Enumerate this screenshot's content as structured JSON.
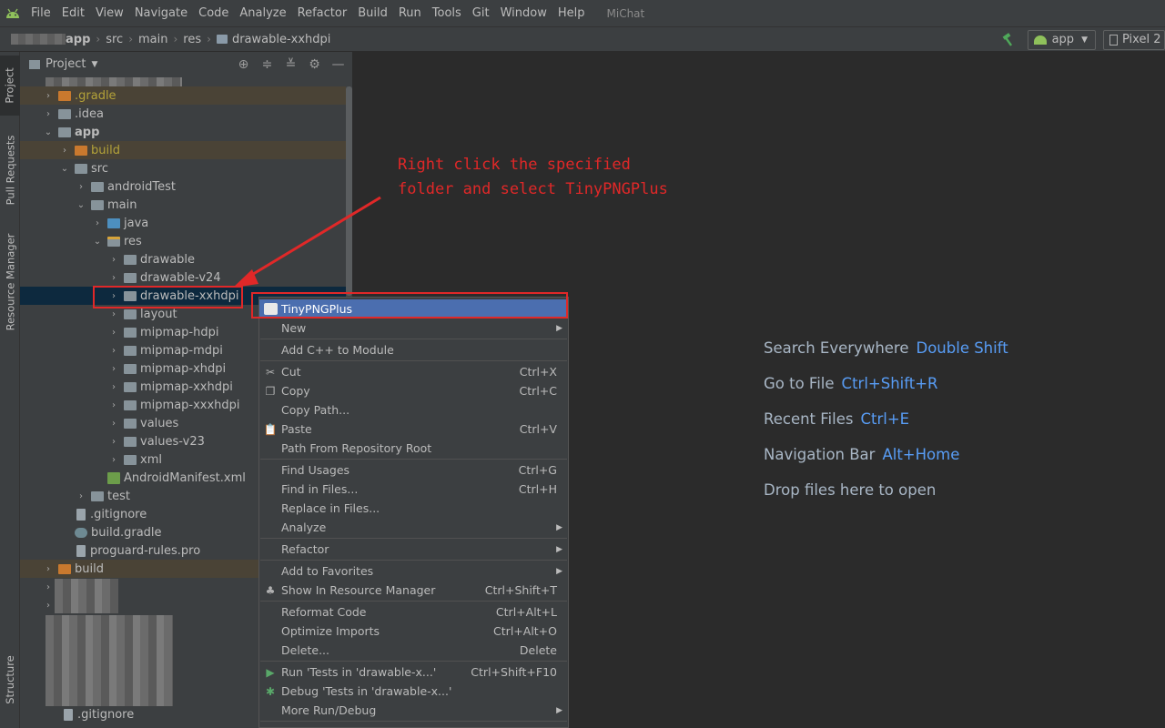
{
  "menubar": {
    "items": [
      {
        "label": "File"
      },
      {
        "label": "Edit"
      },
      {
        "label": "View"
      },
      {
        "label": "Navigate"
      },
      {
        "label": "Code"
      },
      {
        "label": "Analyze"
      },
      {
        "label": "Refactor"
      },
      {
        "label": "Build"
      },
      {
        "label": "Run"
      },
      {
        "label": "Tools"
      },
      {
        "label": "Git"
      },
      {
        "label": "Window"
      },
      {
        "label": "Help"
      }
    ],
    "project_name": "MiChat"
  },
  "navbar": {
    "breadcrumbs": [
      "app",
      "src",
      "main",
      "res",
      "drawable-xxhdpi"
    ],
    "run_config": "app",
    "device": "Pixel 2"
  },
  "toolstrip": {
    "project": "Project",
    "pull_requests": "Pull Requests",
    "resource_manager": "Resource Manager",
    "structure": "Structure"
  },
  "project_panel": {
    "title": "Project",
    "tree": [
      {
        "label": ".gradle",
        "expanded": false
      },
      {
        "label": ".idea",
        "expanded": false
      },
      {
        "label": "app",
        "expanded": true
      },
      {
        "label": "build",
        "expanded": false
      },
      {
        "label": "src",
        "expanded": true
      },
      {
        "label": "androidTest",
        "expanded": false
      },
      {
        "label": "main",
        "expanded": true
      },
      {
        "label": "java",
        "expanded": false
      },
      {
        "label": "res",
        "expanded": true
      },
      {
        "label": "drawable",
        "expanded": false
      },
      {
        "label": "drawable-v24",
        "expanded": false
      },
      {
        "label": "drawable-xxhdpi",
        "expanded": false
      },
      {
        "label": "layout",
        "expanded": false
      },
      {
        "label": "mipmap-hdpi",
        "expanded": false
      },
      {
        "label": "mipmap-mdpi",
        "expanded": false
      },
      {
        "label": "mipmap-xhdpi",
        "expanded": false
      },
      {
        "label": "mipmap-xxhdpi",
        "expanded": false
      },
      {
        "label": "mipmap-xxxhdpi",
        "expanded": false
      },
      {
        "label": "values",
        "expanded": false
      },
      {
        "label": "values-v23",
        "expanded": false
      },
      {
        "label": "xml",
        "expanded": false
      },
      {
        "label": "AndroidManifest.xml"
      },
      {
        "label": "test",
        "expanded": false
      },
      {
        "label": ".gitignore"
      },
      {
        "label": "build.gradle"
      },
      {
        "label": "proguard-rules.pro"
      },
      {
        "label": "build",
        "expanded": false
      },
      {
        "label": ".gitignore"
      }
    ]
  },
  "editor": {
    "hints": [
      {
        "label": "Search Everywhere",
        "key": "Double Shift"
      },
      {
        "label": "Go to File",
        "key": "Ctrl+Shift+R"
      },
      {
        "label": "Recent Files",
        "key": "Ctrl+E"
      },
      {
        "label": "Navigation Bar",
        "key": "Alt+Home"
      },
      {
        "label": "Drop files here to open",
        "key": ""
      }
    ]
  },
  "annotation": {
    "line1": "Right click the specified",
    "line2": "folder and select TinyPNGPlus",
    "color": "#e02828"
  },
  "context_menu": {
    "items": [
      {
        "label": "TinyPNGPlus",
        "shortcut": "",
        "submenu": false,
        "icon": "tinypng-icon"
      },
      {
        "label": "New",
        "shortcut": "",
        "submenu": true
      },
      {
        "label": "Add C++ to Module",
        "shortcut": "",
        "submenu": false
      },
      {
        "label": "Cut",
        "shortcut": "Ctrl+X",
        "submenu": false,
        "icon": "scissors-icon"
      },
      {
        "label": "Copy",
        "shortcut": "Ctrl+C",
        "submenu": false,
        "icon": "copy-icon"
      },
      {
        "label": "Copy Path...",
        "shortcut": "",
        "submenu": false
      },
      {
        "label": "Paste",
        "shortcut": "Ctrl+V",
        "submenu": false,
        "icon": "clipboard-icon"
      },
      {
        "label": "Path From Repository Root",
        "shortcut": "",
        "submenu": false
      },
      {
        "label": "Find Usages",
        "shortcut": "Ctrl+G",
        "submenu": false
      },
      {
        "label": "Find in Files...",
        "shortcut": "Ctrl+H",
        "submenu": false
      },
      {
        "label": "Replace in Files...",
        "shortcut": "",
        "submenu": false
      },
      {
        "label": "Analyze",
        "shortcut": "",
        "submenu": true
      },
      {
        "label": "Refactor",
        "shortcut": "",
        "submenu": true
      },
      {
        "label": "Add to Favorites",
        "shortcut": "",
        "submenu": true
      },
      {
        "label": "Show In Resource Manager",
        "shortcut": "Ctrl+Shift+T",
        "submenu": false,
        "icon": "resource-manager-icon"
      },
      {
        "label": "Reformat Code",
        "shortcut": "Ctrl+Alt+L",
        "submenu": false
      },
      {
        "label": "Optimize Imports",
        "shortcut": "Ctrl+Alt+O",
        "submenu": false
      },
      {
        "label": "Delete...",
        "shortcut": "Delete",
        "submenu": false
      },
      {
        "label": "Run 'Tests in 'drawable-x...'",
        "shortcut": "Ctrl+Shift+F10",
        "submenu": false,
        "icon": "run-icon"
      },
      {
        "label": "Debug 'Tests in 'drawable-x...'",
        "shortcut": "",
        "submenu": false,
        "icon": "debug-icon"
      },
      {
        "label": "More Run/Debug",
        "shortcut": "",
        "submenu": true
      }
    ]
  }
}
